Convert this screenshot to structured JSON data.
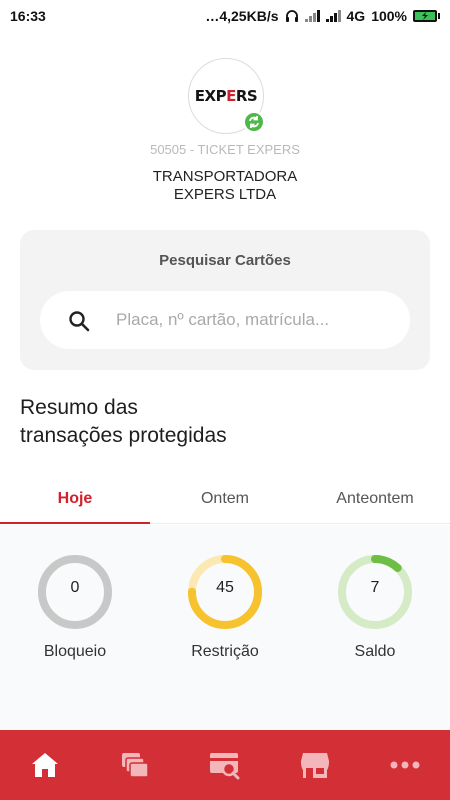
{
  "status_bar": {
    "time": "16:33",
    "network_speed": "…4,25KB/s",
    "network_type": "4G",
    "battery": "100%"
  },
  "header": {
    "logo_text_left": "EXP",
    "logo_text_accent": "E",
    "logo_text_right": "RS",
    "badge_icon": "sync-icon",
    "account_code": "50505 - TICKET EXPERS",
    "company_line1": "TRANSPORTADORA",
    "company_line2": "EXPERS LTDA"
  },
  "search": {
    "title": "Pesquisar Cartões",
    "placeholder": "Placa, nº cartão, matrícula..."
  },
  "summary": {
    "title_line1": "Resumo das",
    "title_line2": "transações protegidas",
    "tabs": [
      {
        "label": "Hoje",
        "active": true
      },
      {
        "label": "Ontem",
        "active": false
      },
      {
        "label": "Anteontem",
        "active": false
      }
    ],
    "stats": [
      {
        "label": "Bloqueio",
        "value": "0",
        "fraction": 0,
        "color": "#c8c8c8",
        "track": "#c8c8c8"
      },
      {
        "label": "Restrição",
        "value": "45",
        "fraction": 0.75,
        "color": "#f6c22e",
        "track": "#fbe8b3"
      },
      {
        "label": "Saldo",
        "value": "7",
        "fraction": 0.12,
        "color": "#6dbe45",
        "track": "#d4ebc6"
      }
    ]
  },
  "bottom_nav": {
    "background": "#d32f36",
    "items": [
      {
        "icon": "home-icon",
        "active": true
      },
      {
        "icon": "cards-icon",
        "active": false
      },
      {
        "icon": "card-search-icon",
        "active": false
      },
      {
        "icon": "store-icon",
        "active": false
      },
      {
        "icon": "more-icon",
        "active": false
      }
    ]
  },
  "colors": {
    "accent": "#d0222e"
  }
}
